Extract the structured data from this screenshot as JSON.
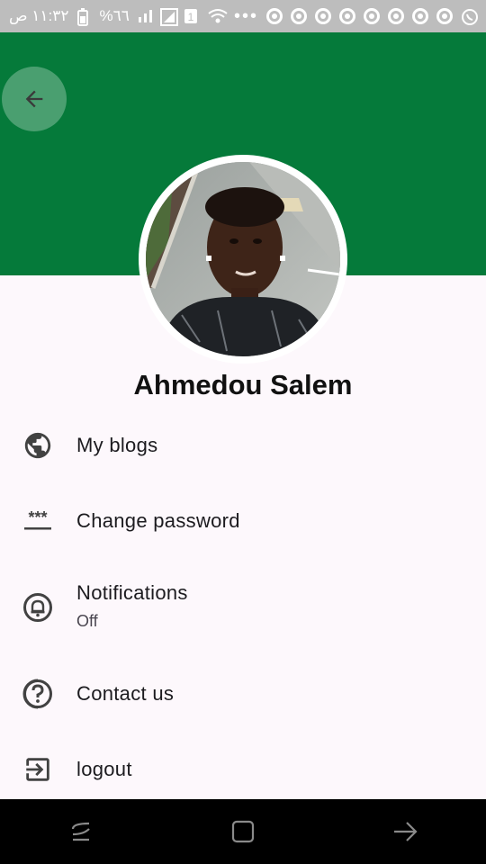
{
  "status_bar": {
    "time": "١١:٣٢ ص",
    "battery": "%٦٦",
    "icons": [
      "battery-icon",
      "signal-icon",
      "sim-icon",
      "wifi-icon",
      "more-icon",
      "chrome-icon",
      "whatsapp-icon"
    ]
  },
  "profile": {
    "name": "Ahmedou Salem"
  },
  "menu": [
    {
      "label": "My blogs",
      "icon": "globe-icon"
    },
    {
      "label": "Change password",
      "icon": "password-icon"
    },
    {
      "label": "Notifications",
      "sublabel": "Off",
      "icon": "bell-icon"
    },
    {
      "label": "Contact us",
      "icon": "help-icon"
    },
    {
      "label": "logout",
      "icon": "logout-icon"
    }
  ],
  "colors": {
    "header": "#057a3a",
    "background": "#fdf8fc",
    "status_bar": "#bdbdbd"
  }
}
